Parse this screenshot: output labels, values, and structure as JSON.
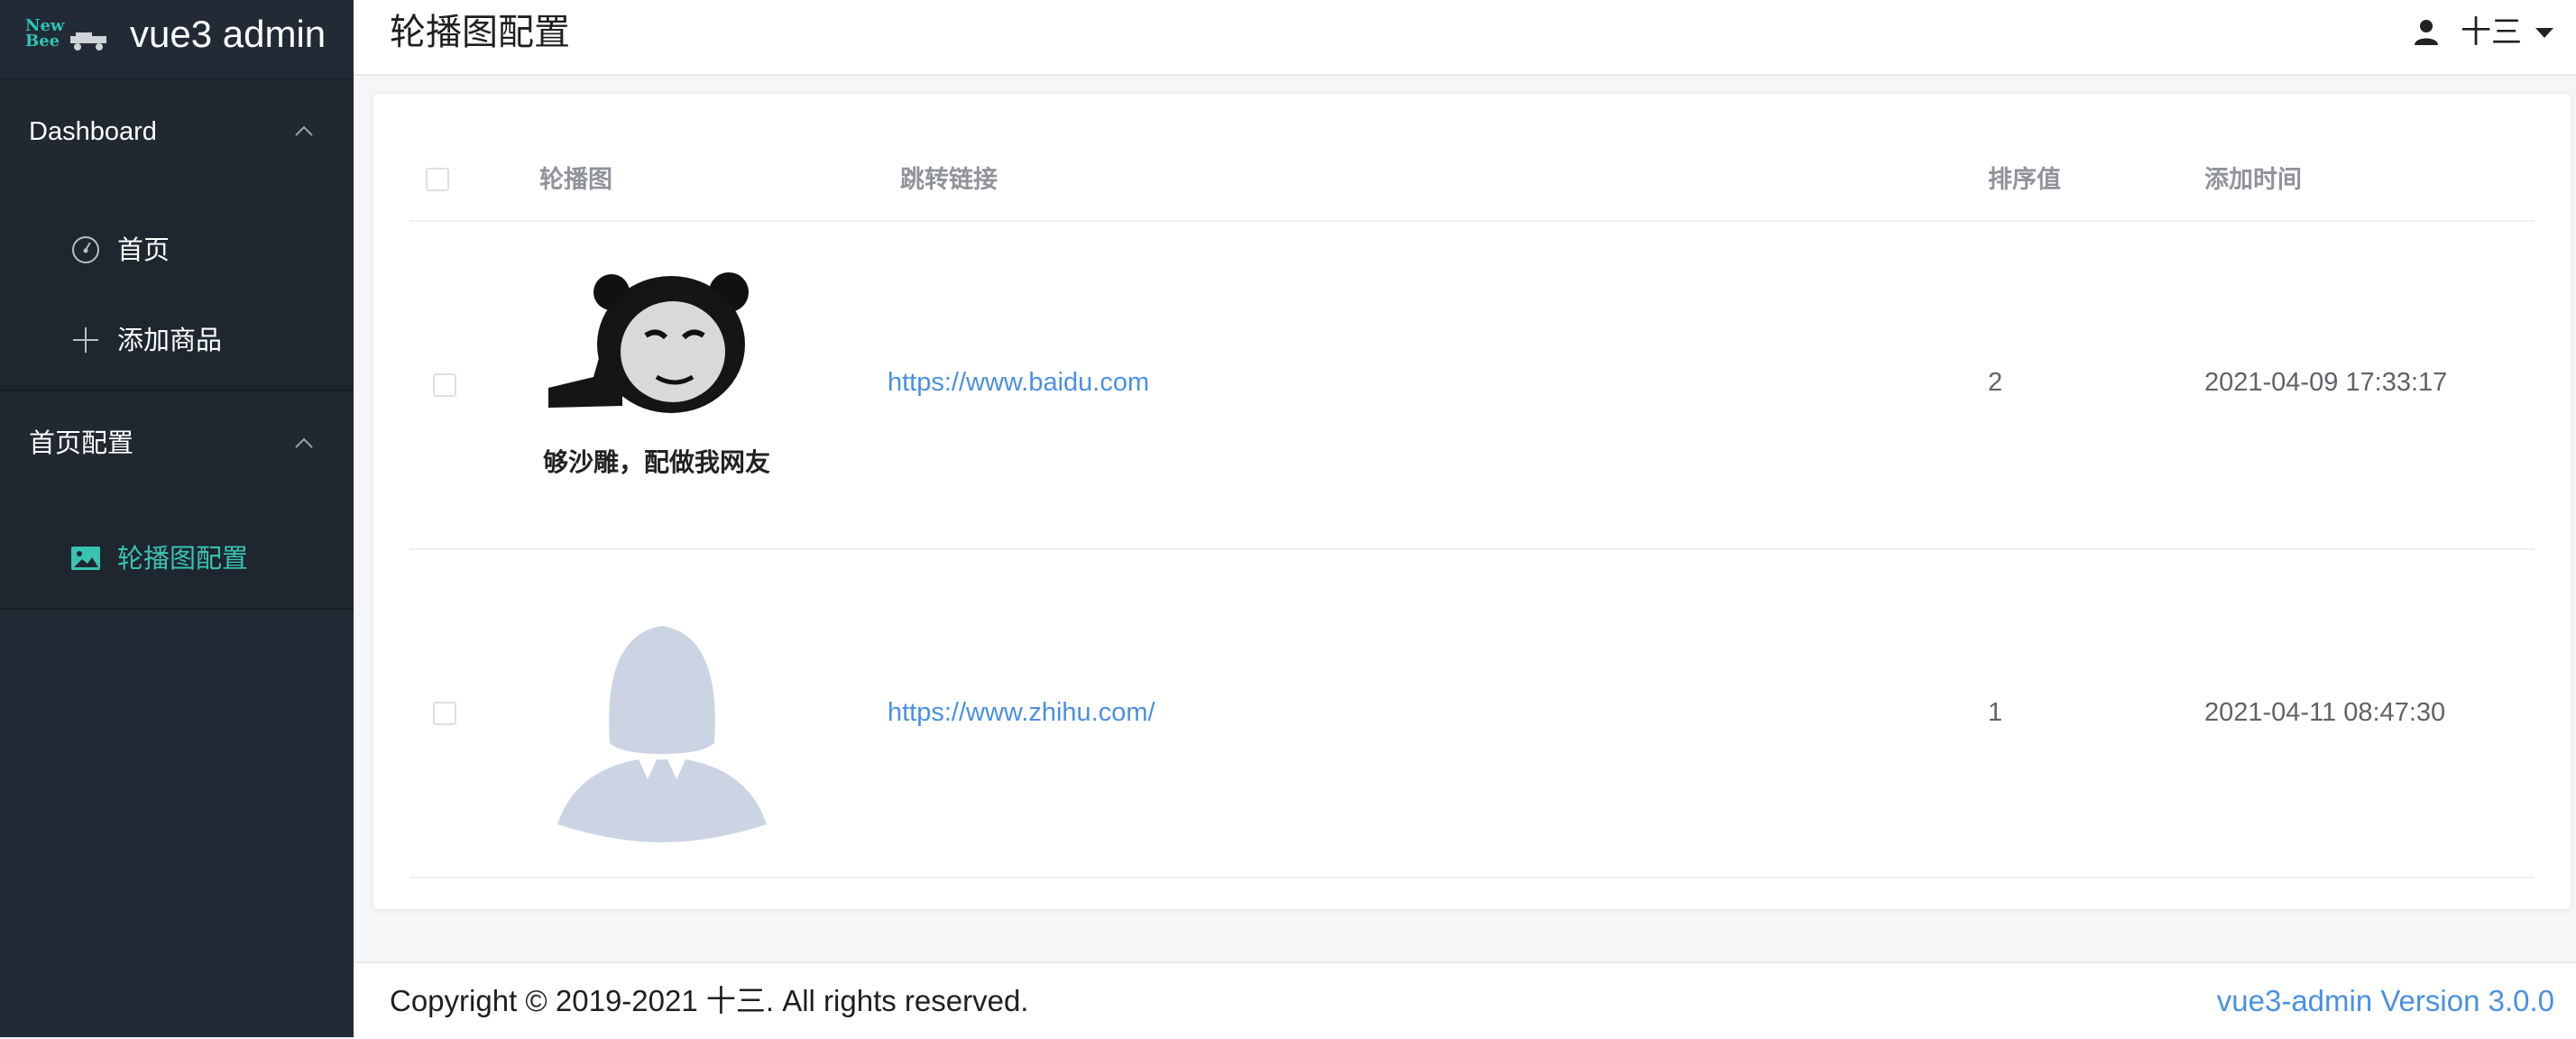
{
  "app": {
    "logo_line1": "New",
    "logo_line2": "Bee",
    "title": "vue3 admin"
  },
  "sidebar": {
    "groups": [
      {
        "title": "Dashboard",
        "items": [
          {
            "label": "首页",
            "icon": "dashboard-icon"
          },
          {
            "label": "添加商品",
            "icon": "plus-icon"
          }
        ]
      },
      {
        "title": "首页配置",
        "items": [
          {
            "label": "轮播图配置",
            "icon": "image-icon",
            "active": true
          }
        ]
      }
    ]
  },
  "header": {
    "title": "轮播图配置",
    "user_name": "十三"
  },
  "table": {
    "columns": [
      "轮播图",
      "跳转链接",
      "排序值",
      "添加时间"
    ],
    "rows": [
      {
        "image_caption": "够沙雕，配做我网友",
        "link": "https://www.baidu.com",
        "sort": "2",
        "created": "2021-04-09 17:33:17"
      },
      {
        "image_caption": "",
        "link": "https://www.zhihu.com/",
        "sort": "1",
        "created": "2021-04-11 08:47:30"
      }
    ]
  },
  "footer": {
    "copyright": "Copyright © 2019-2021 十三. All rights reserved.",
    "version": "vue3-admin Version 3.0.0"
  },
  "colors": {
    "sidebar_bg": "#222b35",
    "accent": "#39c3b1",
    "link": "#4a90e2"
  }
}
